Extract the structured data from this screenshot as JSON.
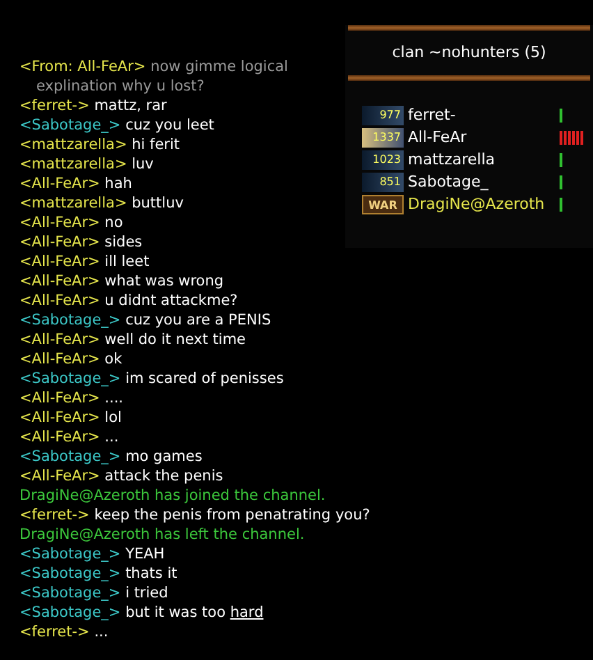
{
  "chat": [
    {
      "kind": "whisper",
      "name": "<From: All-FeAr>",
      "color": "#e6e64c",
      "text": "now gimme logical explination why u lost?"
    },
    {
      "kind": "chat",
      "name": "<ferret->",
      "color": "#e6e64c",
      "text": "mattz, rar"
    },
    {
      "kind": "chat",
      "name": "<Sabotage_>",
      "color": "#3cc8c8",
      "text": "cuz you leet"
    },
    {
      "kind": "chat",
      "name": "<mattzarella>",
      "color": "#e6e64c",
      "text": "hi ferit"
    },
    {
      "kind": "chat",
      "name": "<mattzarella>",
      "color": "#e6e64c",
      "text": "luv"
    },
    {
      "kind": "chat",
      "name": "<All-FeAr>",
      "color": "#e6e64c",
      "text": "hah"
    },
    {
      "kind": "chat",
      "name": "<mattzarella>",
      "color": "#e6e64c",
      "text": "buttluv"
    },
    {
      "kind": "chat",
      "name": "<All-FeAr>",
      "color": "#e6e64c",
      "text": "no"
    },
    {
      "kind": "chat",
      "name": "<All-FeAr>",
      "color": "#e6e64c",
      "text": "sides"
    },
    {
      "kind": "chat",
      "name": "<All-FeAr>",
      "color": "#e6e64c",
      "text": "ill leet"
    },
    {
      "kind": "chat",
      "name": "<All-FeAr>",
      "color": "#e6e64c",
      "text": "what was wrong"
    },
    {
      "kind": "chat",
      "name": "<All-FeAr>",
      "color": "#e6e64c",
      "text": "u didnt attackme?"
    },
    {
      "kind": "chat",
      "name": "<Sabotage_>",
      "color": "#3cc8c8",
      "text": "cuz you are a PENIS"
    },
    {
      "kind": "chat",
      "name": "<All-FeAr>",
      "color": "#e6e64c",
      "text": "well do it next time"
    },
    {
      "kind": "chat",
      "name": "<All-FeAr>",
      "color": "#e6e64c",
      "text": "ok"
    },
    {
      "kind": "chat",
      "name": "<Sabotage_>",
      "color": "#3cc8c8",
      "text": "im scared of penisses"
    },
    {
      "kind": "chat",
      "name": "<All-FeAr>",
      "color": "#e6e64c",
      "text": "...."
    },
    {
      "kind": "chat",
      "name": "<All-FeAr>",
      "color": "#e6e64c",
      "text": "lol"
    },
    {
      "kind": "chat",
      "name": "<All-FeAr>",
      "color": "#e6e64c",
      "text": "..."
    },
    {
      "kind": "chat",
      "name": "<Sabotage_>",
      "color": "#3cc8c8",
      "text": "mo games"
    },
    {
      "kind": "chat",
      "name": "<All-FeAr>",
      "color": "#e6e64c",
      "text": "attack the penis"
    },
    {
      "kind": "system",
      "text": "DragiNe@Azeroth has joined the channel."
    },
    {
      "kind": "chat",
      "name": "<ferret->",
      "color": "#e6e64c",
      "text": "keep the penis from penatrating you?"
    },
    {
      "kind": "system",
      "text": "DragiNe@Azeroth has left the channel."
    },
    {
      "kind": "chat",
      "name": "<Sabotage_>",
      "color": "#3cc8c8",
      "text": "YEAH"
    },
    {
      "kind": "chat",
      "name": "<Sabotage_>",
      "color": "#3cc8c8",
      "text": "thats it"
    },
    {
      "kind": "chat",
      "name": "<Sabotage_>",
      "color": "#3cc8c8",
      "text": "i tried"
    },
    {
      "kind": "chat",
      "name": "<Sabotage_>",
      "color": "#3cc8c8",
      "text": "but it was too ",
      "link": "hard"
    },
    {
      "kind": "chat",
      "name": "<ferret->",
      "color": "#e6e64c",
      "text": "..."
    }
  ],
  "channel": {
    "title": "clan ~nohunters (5)",
    "users": [
      {
        "kind": "rank",
        "badge": "977",
        "name": "ferret-",
        "color": "#ffffff",
        "high_latency": false
      },
      {
        "kind": "gold",
        "badge": "1337",
        "name": "All-FeAr",
        "color": "#ffffff",
        "high_latency": true
      },
      {
        "kind": "rank",
        "badge": "1023",
        "name": "mattzarella",
        "color": "#ffffff",
        "high_latency": false
      },
      {
        "kind": "rank",
        "badge": "851",
        "name": "Sabotage_",
        "color": "#ffffff",
        "high_latency": false
      },
      {
        "kind": "war",
        "badge": "WAR",
        "name": "DragiNe@Azeroth",
        "color": "#e6e64c",
        "high_latency": false
      }
    ]
  }
}
